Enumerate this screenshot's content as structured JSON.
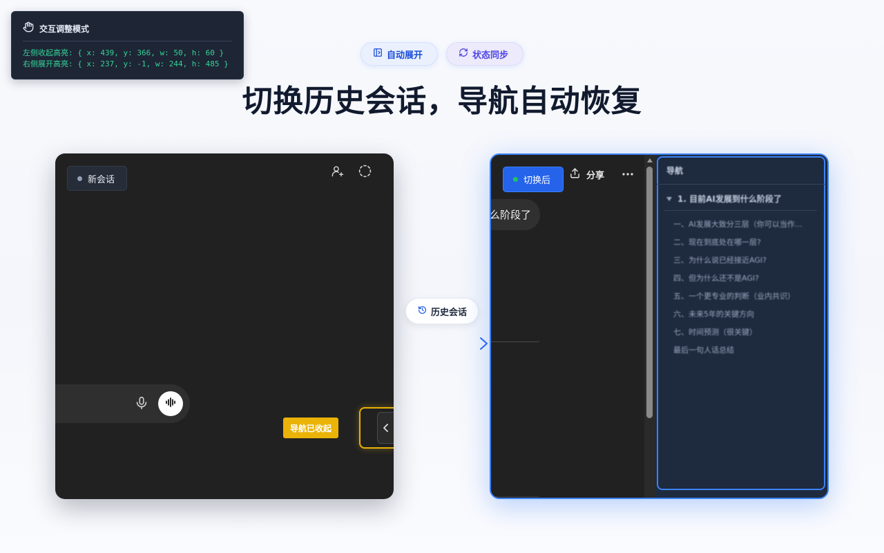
{
  "debug_panel": {
    "title": "交互调整模式",
    "line_left": "左侧收起高亮: { x: 439, y: 366, w: 50, h: 60 }",
    "line_right": "右侧展开高亮: { x: 237, y: -1, w: 244, h: 485 }",
    "text_color": "#34d399"
  },
  "header": {
    "pill_expand": "自动展开",
    "pill_sync": "状态同步",
    "title": "切换历史会话，导航自动恢复"
  },
  "left_card": {
    "new_chat_label": "新会话",
    "collapsed_badge": "导航已收起",
    "badge_color": "#eab308"
  },
  "middle": {
    "history_label": "历史会话",
    "accent": "#2563eb"
  },
  "right_card": {
    "switched_label": "切换后",
    "share_label": "分享",
    "message_fragment": "么阶段了",
    "nav": {
      "title": "导航",
      "section": "1. 目前AI发展到什么阶段了",
      "items": [
        "一、AI发展大致分三层（你可以当作…",
        "二、现在到底处在哪一层?",
        "三、为什么说已经接近AGI?",
        "四、但为什么还不是AGI?",
        "五、一个更专业的判断（业内共识）",
        "六、未来5年的关键方向",
        "七、时间预测（很关键）",
        "最后一句人话总结"
      ]
    }
  }
}
